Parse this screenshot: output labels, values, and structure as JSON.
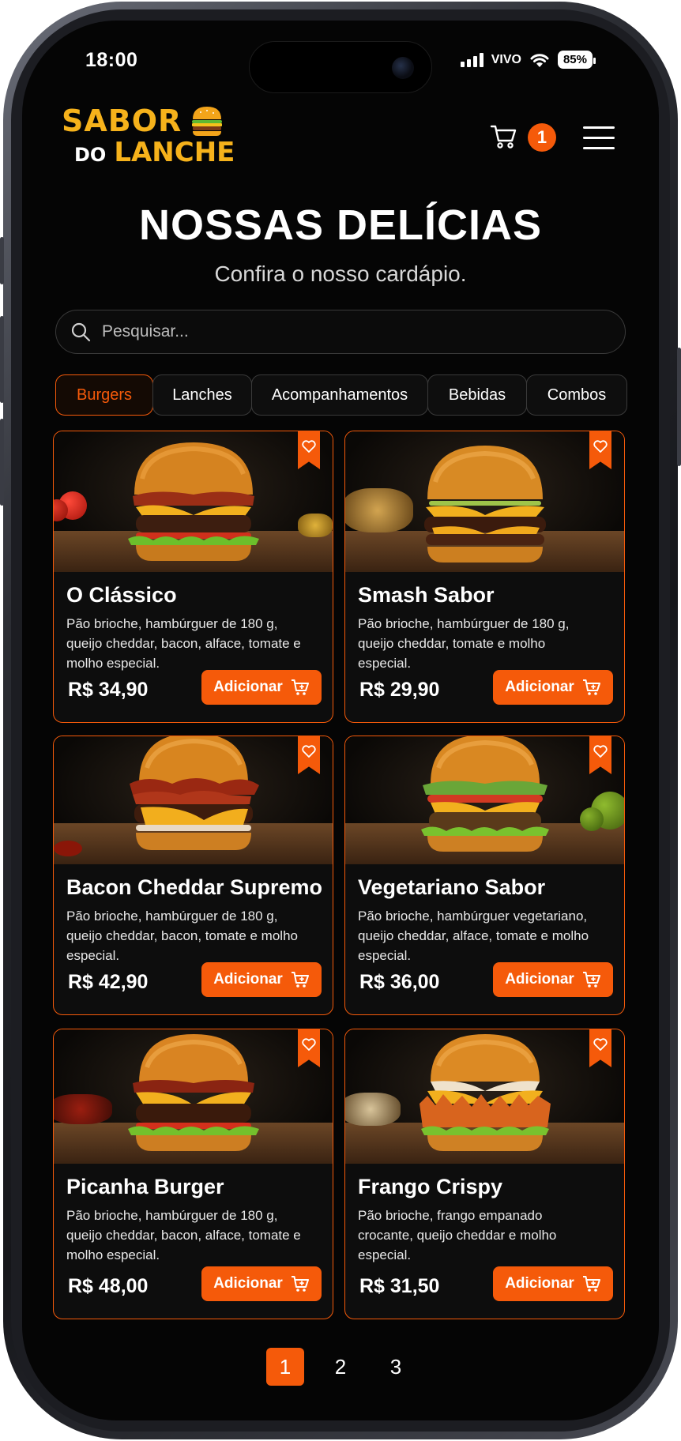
{
  "status": {
    "time": "18:00",
    "carrier": "VIVO",
    "battery": "85%"
  },
  "brand": {
    "line1": "SABOR",
    "line2_prefix": "DO",
    "line2": "LANCHE"
  },
  "cart": {
    "count": "1"
  },
  "hero": {
    "title": "NOSSAS DELÍCIAS",
    "subtitle": "Confira o nosso cardápio."
  },
  "search": {
    "placeholder": "Pesquisar..."
  },
  "tabs": [
    {
      "label": "Burgers",
      "active": true
    },
    {
      "label": "Lanches"
    },
    {
      "label": "Acompanhamentos"
    },
    {
      "label": "Bebidas"
    },
    {
      "label": "Combos"
    }
  ],
  "add_label": "Adicionar",
  "products": [
    {
      "name": "O Clássico",
      "description": "Pão brioche, hambúrguer de 180 g, queijo cheddar, bacon, alface, tomate e molho especial.",
      "price": "R$ 34,90"
    },
    {
      "name": "Smash Sabor",
      "description": "Pão brioche, hambúrguer de 180 g, queijo cheddar, tomate e molho especial.",
      "price": "R$ 29,90"
    },
    {
      "name": "Bacon Cheddar Supremo",
      "description": "Pão brioche, hambúrguer de 180 g, queijo cheddar, bacon, tomate e molho especial.",
      "price": "R$ 42,90"
    },
    {
      "name": "Vegetariano Sabor",
      "description": "Pão brioche, hambúrguer vegetariano, queijo cheddar, alface, tomate e molho especial.",
      "price": "R$ 36,00"
    },
    {
      "name": "Picanha Burger",
      "description": "Pão brioche, hambúrguer de 180 g, queijo cheddar, bacon, alface, tomate e molho especial.",
      "price": "R$ 48,00"
    },
    {
      "name": "Frango Crispy",
      "description": "Pão brioche, frango empanado crocante, queijo cheddar e molho especial.",
      "price": "R$ 31,50"
    }
  ],
  "pagination": {
    "pages": [
      "1",
      "2",
      "3"
    ],
    "current": "1"
  },
  "colors": {
    "accent": "#f55a0a",
    "brand_yellow": "#f6b21b",
    "background": "#050505"
  }
}
